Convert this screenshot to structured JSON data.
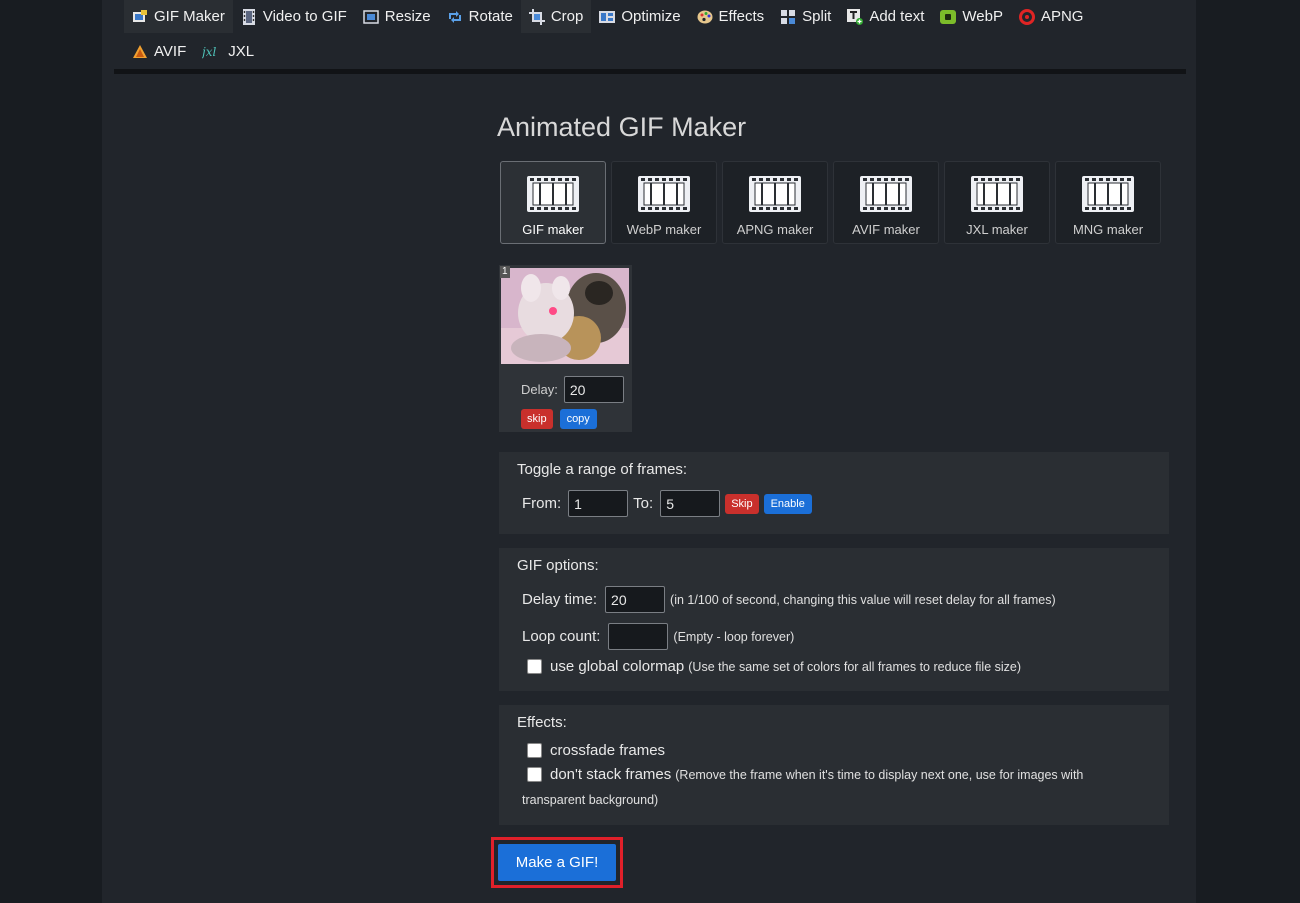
{
  "nav": {
    "row1": [
      {
        "label": "GIF Maker",
        "icon": "gif-maker-icon"
      },
      {
        "label": "Video to GIF",
        "icon": "film-icon"
      },
      {
        "label": "Resize",
        "icon": "resize-icon"
      },
      {
        "label": "Rotate",
        "icon": "rotate-icon"
      },
      {
        "label": "Crop",
        "icon": "crop-icon"
      },
      {
        "label": "Optimize",
        "icon": "optimize-icon"
      },
      {
        "label": "Effects",
        "icon": "palette-icon"
      },
      {
        "label": "Split",
        "icon": "split-icon"
      },
      {
        "label": "Add text",
        "icon": "add-text-icon"
      },
      {
        "label": "WebP",
        "icon": "webp-icon"
      },
      {
        "label": "APNG",
        "icon": "apng-icon"
      }
    ],
    "row2": [
      {
        "label": "AVIF",
        "icon": "avif-icon"
      },
      {
        "label": "JXL",
        "icon": "jxl-icon"
      }
    ]
  },
  "page_title": "Animated GIF Maker",
  "makers": [
    "GIF maker",
    "WebP maker",
    "APNG maker",
    "AVIF maker",
    "JXL maker",
    "MNG maker"
  ],
  "frame": {
    "number": "1",
    "delay_label": "Delay:",
    "delay_value": "20",
    "skip_label": "skip",
    "copy_label": "copy"
  },
  "toggle_range": {
    "title": "Toggle a range of frames:",
    "from_label": "From:",
    "from_value": "1",
    "to_label": "To:",
    "to_value": "5",
    "skip_label": "Skip",
    "enable_label": "Enable"
  },
  "gif_options": {
    "title": "GIF options:",
    "delay_label": "Delay time:",
    "delay_value": "20",
    "delay_hint": "(in 1/100 of second, changing this value will reset delay for all frames)",
    "loop_label": "Loop count:",
    "loop_value": "",
    "loop_hint": "(Empty - loop forever)",
    "colormap_label": "use global colormap",
    "colormap_hint": "(Use the same set of colors for all frames to reduce file size)"
  },
  "effects": {
    "title": "Effects:",
    "crossfade_label": "crossfade frames",
    "nostack_label": "don't stack frames",
    "nostack_hint": "(Remove the frame when it's time to display next one, use for images with",
    "nostack_hint2": "transparent background)"
  },
  "make_button": "Make a GIF!",
  "colors": {
    "accent_blue": "#1b6fd8",
    "danger_red": "#c9302c",
    "highlight_box": "#e0202a"
  }
}
